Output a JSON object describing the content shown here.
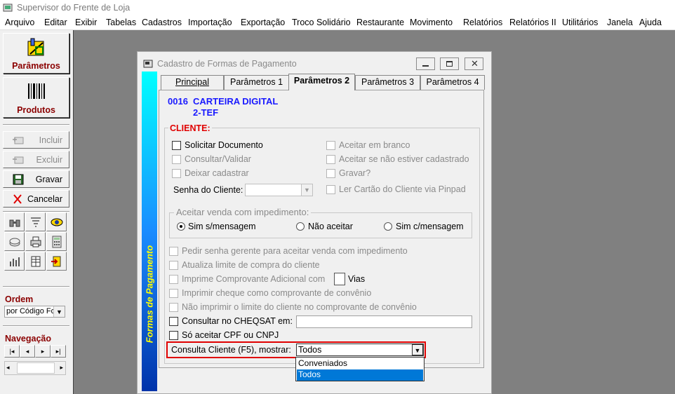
{
  "app": {
    "title": "Supervisor do Frente de Loja"
  },
  "menu": [
    "Arquivo",
    "Editar",
    "Exibir",
    "Tabelas",
    "Cadastros",
    "Importação",
    "Exportação",
    "Troco Solidário",
    "Restaurante",
    "Movimento",
    "Relatórios",
    "Relatórios II",
    "Utilitários",
    "Janela",
    "Ajuda"
  ],
  "sidebar": {
    "parametros": "Parâmetros",
    "produtos": "Produtos",
    "incluir": "Incluir",
    "excluir": "Excluir",
    "gravar": "Gravar",
    "cancelar": "Cancelar",
    "ordem_label": "Ordem",
    "ordem_value": "por Código Fo",
    "navegacao_label": "Navegação"
  },
  "dialog": {
    "title": "Cadastro de Formas de Pagamento",
    "side_caption": "Formas de Pagamento",
    "tabs": [
      "Principal",
      "Parâmetros 1",
      "Parâmetros 2",
      "Parâmetros 3",
      "Parâmetros 4"
    ],
    "active_tab": "Parâmetros 2",
    "code": "0016",
    "name": "CARTEIRA DIGITAL",
    "subname": "2-TEF",
    "cliente_group": "CLIENTE:",
    "solicitar_documento": "Solicitar Documento",
    "consultar_validar": "Consultar/Validar",
    "deixar_cadastrar": "Deixar cadastrar",
    "senha_cliente": "Senha do Cliente:",
    "aceitar_branco": "Aceitar em branco",
    "aceitar_nao_cadastrado": "Aceitar se não estiver cadastrado",
    "gravar_q": "Gravar?",
    "ler_cartao": "Ler Cartão do Cliente via Pinpad",
    "impedimento_group": "Aceitar venda com impedimento:",
    "radio_sim_s": "Sim s/mensagem",
    "radio_nao": "Não aceitar",
    "radio_sim_c": "Sim c/mensagem",
    "pedir_senha": "Pedir senha gerente para aceitar venda com impedimento",
    "atualiza_limite": "Atualiza limite de compra do cliente",
    "imprime_comprovante": "Imprime Comprovante Adicional com",
    "vias": "Vias",
    "imprimir_cheque": "Imprimir cheque como comprovante de convênio",
    "nao_imprimir_limite": "Não imprimir o limite do cliente no comprovante de convênio",
    "consultar_cheqsat": "Consultar no CHEQSAT em:",
    "so_aceitar_cpf": "Só aceitar CPF ou CNPJ",
    "consulta_cliente_label": "Consulta Cliente (F5), mostrar:",
    "consulta_cliente_value": "Todos",
    "dropdown_options": [
      "Conveniados",
      "Todos"
    ],
    "dropdown_selected": "Todos"
  }
}
